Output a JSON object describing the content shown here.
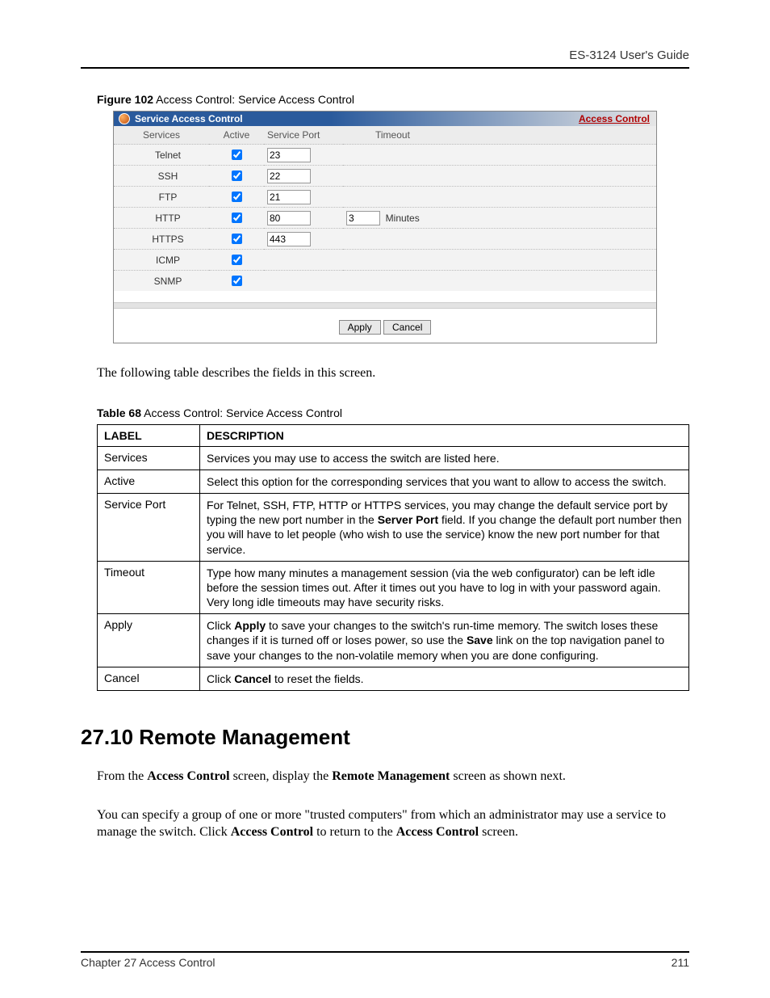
{
  "header": {
    "guide": "ES-3124 User's Guide"
  },
  "figure": {
    "caption_bold": "Figure 102",
    "caption_rest": "   Access Control: Service Access Control",
    "panel_title": "Service Access Control",
    "breadcrumb_link": "Access Control",
    "columns": {
      "services": "Services",
      "active": "Active",
      "service_port": "Service Port",
      "timeout": "Timeout"
    },
    "rows": [
      {
        "service": "Telnet",
        "active": true,
        "port": "23",
        "timeout": ""
      },
      {
        "service": "SSH",
        "active": true,
        "port": "22",
        "timeout": ""
      },
      {
        "service": "FTP",
        "active": true,
        "port": "21",
        "timeout": ""
      },
      {
        "service": "HTTP",
        "active": true,
        "port": "80",
        "timeout": "3",
        "timeout_unit": "Minutes"
      },
      {
        "service": "HTTPS",
        "active": true,
        "port": "443",
        "timeout": ""
      },
      {
        "service": "ICMP",
        "active": true,
        "port": "",
        "timeout": ""
      },
      {
        "service": "SNMP",
        "active": true,
        "port": "",
        "timeout": ""
      }
    ],
    "buttons": {
      "apply": "Apply",
      "cancel": "Cancel"
    }
  },
  "intro_para": "The following table describes the fields in this screen.",
  "table_caption": {
    "bold": "Table 68",
    "rest": "   Access Control: Service Access Control"
  },
  "doc_table": {
    "headers": {
      "label": "LABEL",
      "description": "DESCRIPTION"
    },
    "rows": [
      {
        "label": "Services",
        "desc": "Services you may use to access the switch are listed here."
      },
      {
        "label": "Active",
        "desc": "Select this option for the corresponding services that you want to allow to access the switch."
      },
      {
        "label": "Service Port",
        "desc_pre": "For Telnet, SSH, FTP, HTTP or HTTPS services, you may change the default service port by typing the new port number in the ",
        "desc_bold": "Server Port",
        "desc_post": " field. If you change the default port number then you will have to let people (who wish to use the service) know the new port number for that service."
      },
      {
        "label": "Timeout",
        "desc": "Type how many minutes a management session (via the web configurator) can be left idle before the session times out. After it times out you have to log in with your password again. Very long idle timeouts may have security risks."
      },
      {
        "label": "Apply",
        "desc_pre": "Click ",
        "desc_bold": "Apply",
        "desc_mid": " to save your changes to the switch's run-time memory. The switch loses these changes if it is turned off or loses power, so use the ",
        "desc_bold2": "Save",
        "desc_post": " link on the top navigation panel to save your changes to the non-volatile memory when you are done configuring."
      },
      {
        "label": "Cancel",
        "desc_pre": "Click ",
        "desc_bold": "Cancel",
        "desc_post": " to reset the fields."
      }
    ]
  },
  "section": {
    "heading": "27.10  Remote Management",
    "p1_pre": "From the ",
    "p1_b1": "Access Control",
    "p1_mid": " screen, display the ",
    "p1_b2": "Remote Management",
    "p1_post": " screen as shown next.",
    "p2_pre": "You can specify a group of one or more \"trusted computers\" from which an administrator may use a service to manage the switch. Click ",
    "p2_b1": "Access Control",
    "p2_mid": " to return to the ",
    "p2_b2": "Access Control",
    "p2_post": " screen."
  },
  "footer": {
    "left": "Chapter 27 Access Control",
    "right": "211"
  }
}
